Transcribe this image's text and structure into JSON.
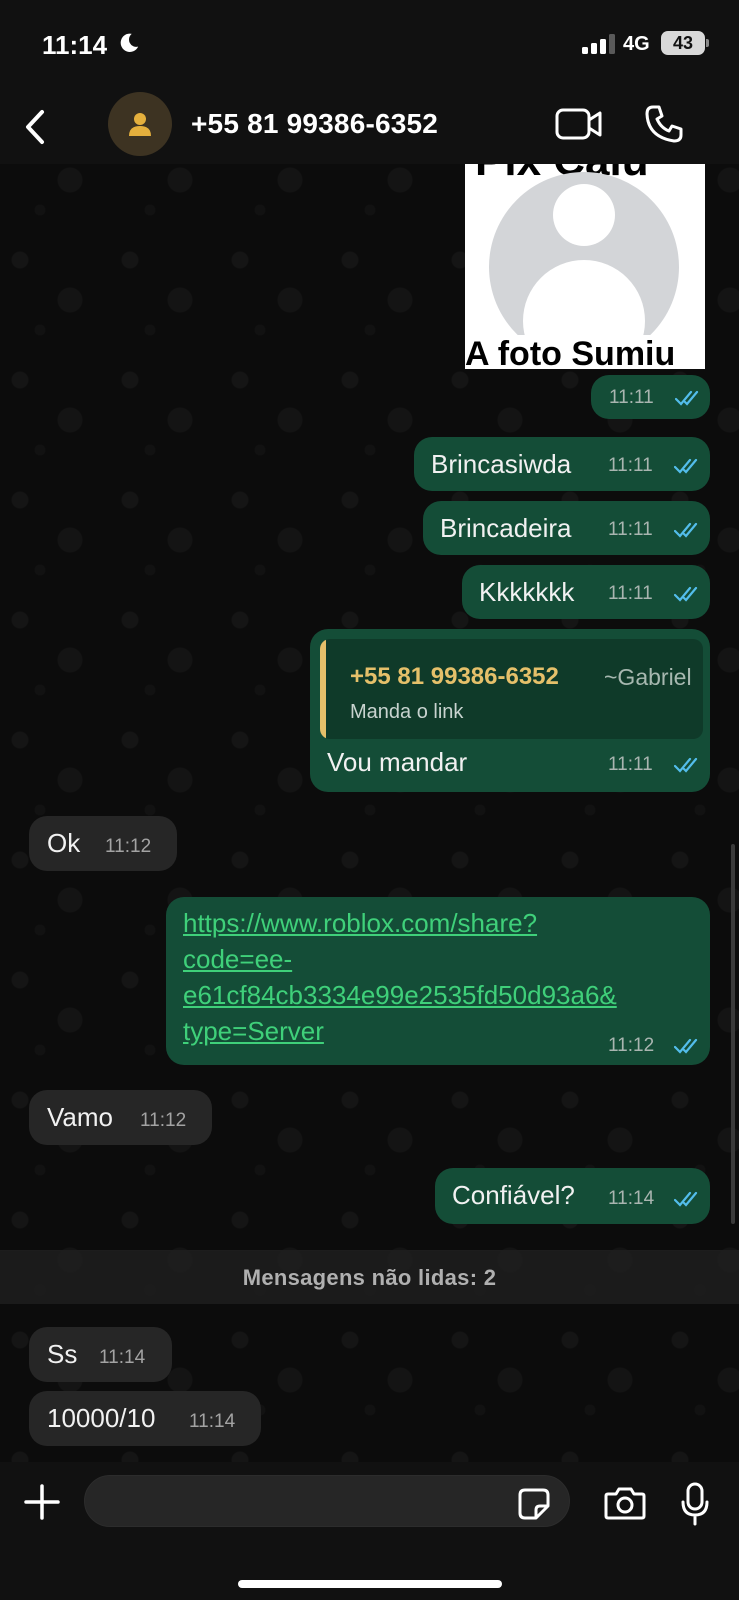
{
  "status_bar": {
    "time": "11:14",
    "network": "4G",
    "battery": "43",
    "moon_icon": "moon-icon",
    "signal_icon": "cellular-signal-icon"
  },
  "header": {
    "contact": "+55 81 99386-6352",
    "back_icon": "chevron-left-icon",
    "avatar_icon": "person-icon",
    "video_icon": "video-camera-icon",
    "phone_icon": "phone-icon"
  },
  "image_message": {
    "top_text": "Pix Caiu",
    "bottom_text": "A foto Sumiu",
    "time": "11:11"
  },
  "messages": [
    {
      "dir": "out",
      "text": "Brincasiwda",
      "time": "11:11"
    },
    {
      "dir": "out",
      "text": "Brincadeira",
      "time": "11:11"
    },
    {
      "dir": "out",
      "text": "Kkkkkkk",
      "time": "11:11"
    },
    {
      "dir": "out",
      "text": "Vou mandar",
      "time": "11:11",
      "quote": {
        "author": "+55 81 99386-6352",
        "pushname": "~Gabriel",
        "text": "Manda o link"
      }
    },
    {
      "dir": "in",
      "text": "Ok",
      "time": "11:12"
    },
    {
      "dir": "out",
      "link": [
        "https://www.roblox.com/share?",
        "code=ee-",
        "e61cf84cb3334e99e2535fd50d93a6&",
        "type=Server"
      ],
      "time": "11:12"
    },
    {
      "dir": "in",
      "text": "Vamo",
      "time": "11:12"
    },
    {
      "dir": "out",
      "text": "Confiável?",
      "time": "11:14"
    },
    {
      "dir": "in",
      "text": "Ss",
      "time": "11:14"
    },
    {
      "dir": "in",
      "text": "10000/10",
      "time": "11:14"
    }
  ],
  "unread_divider": "Mensagens não lidas: 2",
  "composer": {
    "placeholder": "",
    "plus_icon": "plus-icon",
    "sticker_icon": "sticker-icon",
    "camera_icon": "camera-icon",
    "mic_icon": "microphone-icon"
  },
  "colors": {
    "outgoing_bubble": "#144d37",
    "incoming_bubble": "#262626",
    "read_ticks": "#53bdeb",
    "link": "#3fd07a",
    "quote_author": "#e5c06a"
  }
}
